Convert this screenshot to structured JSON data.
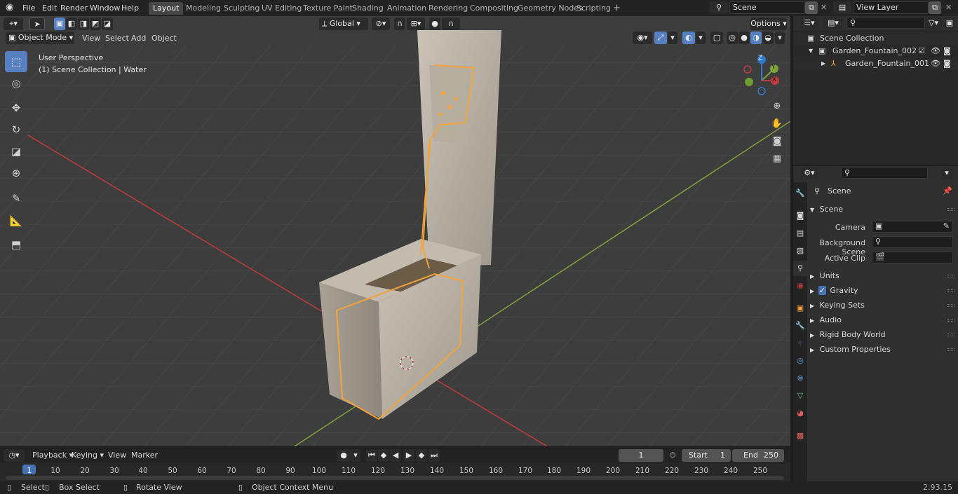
{
  "topbar": {
    "menu": [
      "File",
      "Edit",
      "Render",
      "Window",
      "Help"
    ],
    "workspaces": [
      "Layout",
      "Modeling",
      "Sculpting",
      "UV Editing",
      "Texture Paint",
      "Shading",
      "Animation",
      "Rendering",
      "Compositing",
      "Geometry Nodes",
      "Scripting"
    ],
    "active_workspace": "Layout",
    "add_tab": "+",
    "scene_name": "Scene",
    "view_layer": "View Layer"
  },
  "viewport_header": {
    "mode": "Object Mode",
    "menus": [
      "View",
      "Select",
      "Add",
      "Object"
    ],
    "transform_orientation": "Global",
    "options": "Options"
  },
  "viewport": {
    "perspective": "User Perspective",
    "collection_info": "(1) Scene Collection | Water",
    "gizmo_axes": [
      "X",
      "Y",
      "Z"
    ]
  },
  "outliner": {
    "root": "Scene Collection",
    "items": [
      {
        "label": "Garden_Fountain_002"
      },
      {
        "label": "Garden_Fountain_001"
      }
    ]
  },
  "properties": {
    "context_label": "Scene",
    "panel_title": "Scene",
    "fields": [
      {
        "label": "Camera"
      },
      {
        "label": "Background Scene"
      },
      {
        "label": "Active Clip"
      }
    ],
    "panels": [
      "Units",
      "Gravity",
      "Keying Sets",
      "Audio",
      "Rigid Body World",
      "Custom Properties"
    ]
  },
  "timeline": {
    "menus": [
      "Playback",
      "Keying",
      "View",
      "Marker"
    ],
    "current_frame": "1",
    "start_label": "Start",
    "start_value": "1",
    "end_label": "End",
    "end_value": "250",
    "ruler": [
      "1",
      "10",
      "20",
      "30",
      "40",
      "50",
      "60",
      "70",
      "80",
      "90",
      "100",
      "110",
      "120",
      "130",
      "140",
      "150",
      "160",
      "170",
      "180",
      "190",
      "200",
      "210",
      "220",
      "230",
      "240",
      "250"
    ]
  },
  "statusbar": {
    "select": "Select",
    "box_select": "Box Select",
    "rotate_view": "Rotate View",
    "context_menu": "Object Context Menu",
    "version": "2.93.15"
  },
  "colors": {
    "accent": "#5680c2",
    "selection_outline": "#f5a33a",
    "x_axis": "#c0393e",
    "y_axis": "#7fa23b",
    "z_axis": "#2f7ad1"
  }
}
